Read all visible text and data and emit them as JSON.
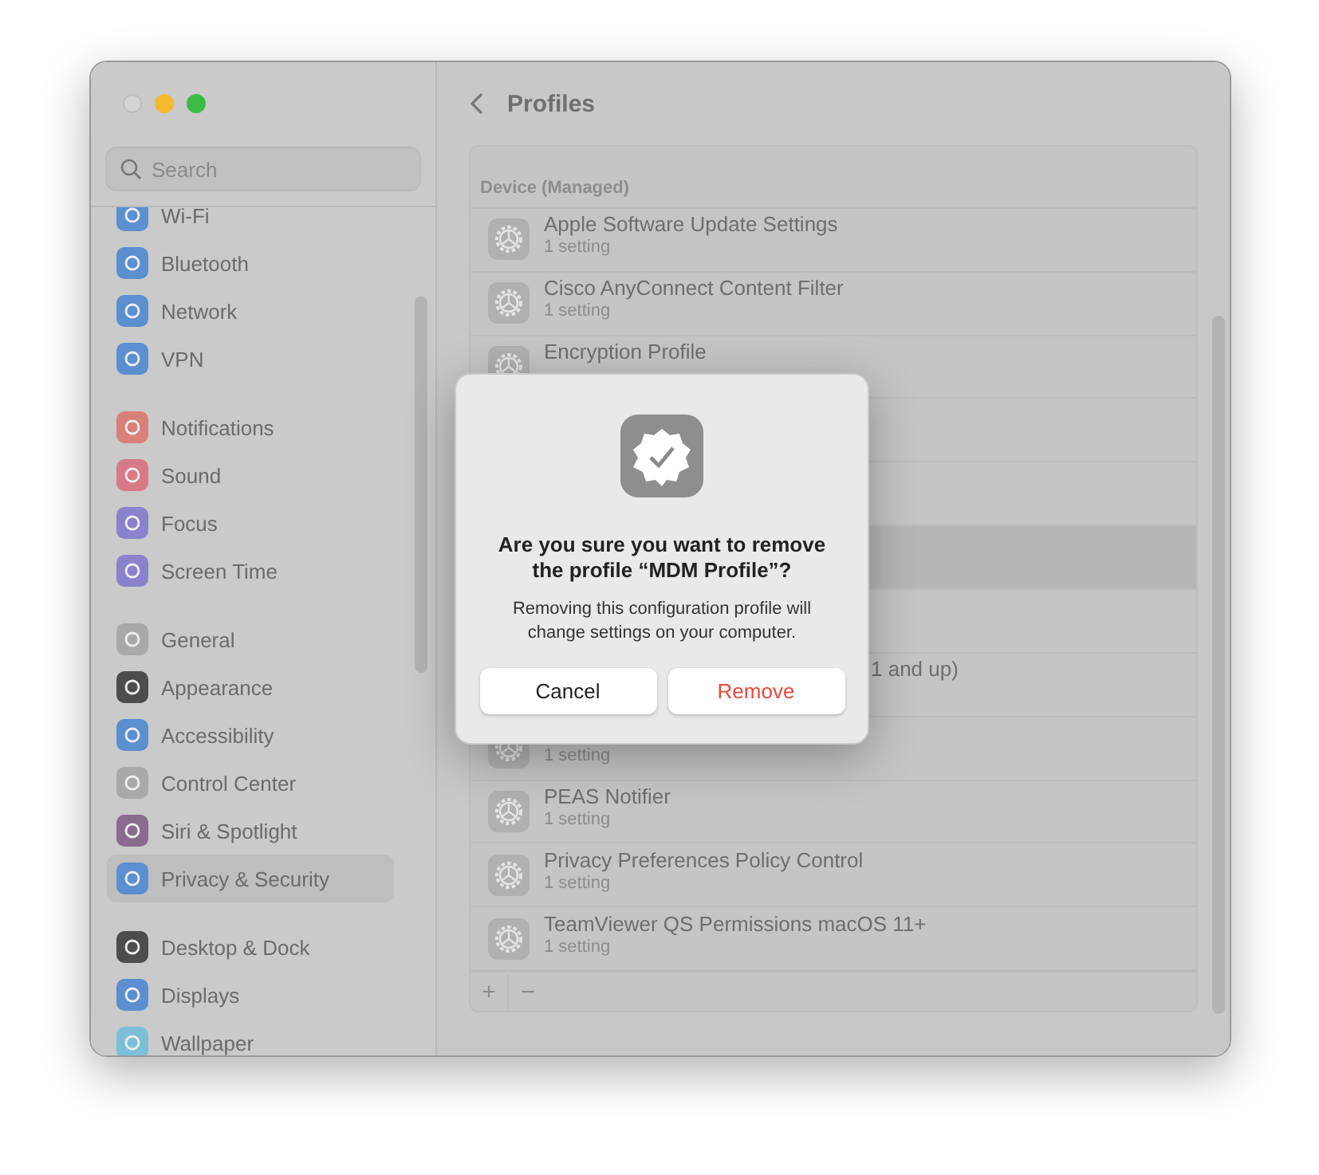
{
  "window": {
    "title": "Profiles"
  },
  "sidebar": {
    "search": {
      "placeholder": "Search"
    },
    "groups": [
      {
        "items": [
          {
            "label": "Wi-Fi",
            "color": "#5b8fd0",
            "selected": false
          },
          {
            "label": "Bluetooth",
            "color": "#5b8fd0",
            "selected": false
          },
          {
            "label": "Network",
            "color": "#5b8fd0",
            "selected": false
          },
          {
            "label": "VPN",
            "color": "#5b8fd0",
            "selected": false
          }
        ]
      },
      {
        "items": [
          {
            "label": "Notifications",
            "color": "#d98078",
            "selected": false
          },
          {
            "label": "Sound",
            "color": "#d87a86",
            "selected": false
          },
          {
            "label": "Focus",
            "color": "#8a82cc",
            "selected": false
          },
          {
            "label": "Screen Time",
            "color": "#8a82cc",
            "selected": false
          }
        ]
      },
      {
        "items": [
          {
            "label": "General",
            "color": "#a9a9a9",
            "selected": false
          },
          {
            "label": "Appearance",
            "color": "#4d4d4d",
            "selected": false
          },
          {
            "label": "Accessibility",
            "color": "#5b8fd0",
            "selected": false
          },
          {
            "label": "Control Center",
            "color": "#a9a9a9",
            "selected": false
          },
          {
            "label": "Siri & Spotlight",
            "color": "#8a6a8e",
            "selected": false
          },
          {
            "label": "Privacy & Security",
            "color": "#5b8fd0",
            "selected": true
          }
        ]
      },
      {
        "items": [
          {
            "label": "Desktop & Dock",
            "color": "#4d4d4d",
            "selected": false
          },
          {
            "label": "Displays",
            "color": "#5b8fd0",
            "selected": false
          },
          {
            "label": "Wallpaper",
            "color": "#7cc0d8",
            "selected": false
          }
        ]
      }
    ]
  },
  "profiles": {
    "section": "Device (Managed)",
    "rows": [
      {
        "kind": "full",
        "title": "Apple Software Update Settings",
        "subtitle": "1 setting",
        "selected": false
      },
      {
        "kind": "full",
        "title": "Cisco AnyConnect Content Filter",
        "subtitle": "1 setting",
        "selected": false
      },
      {
        "kind": "full",
        "title": "Encryption Profile",
        "selected": false
      },
      {
        "kind": "covered",
        "selected": false
      },
      {
        "kind": "covered",
        "selected": false
      },
      {
        "kind": "covered",
        "selected": true
      },
      {
        "kind": "covered",
        "selected": false
      },
      {
        "kind": "clipped",
        "title": "1 and up)",
        "selected": false
      },
      {
        "kind": "full",
        "subtitle": "1 setting",
        "selected": false
      },
      {
        "kind": "full",
        "title": "PEAS Notifier",
        "subtitle": "1 setting",
        "selected": false
      },
      {
        "kind": "full",
        "title": "Privacy Preferences Policy Control",
        "subtitle": "1 setting",
        "selected": false
      },
      {
        "kind": "full",
        "title": "TeamViewer QS Permissions macOS 11+",
        "subtitle": "1 setting",
        "selected": false
      }
    ],
    "add_button": "+",
    "remove_button": "−"
  },
  "dialog": {
    "title": "Are you sure you want to remove the profile “MDM Profile”?",
    "message": "Removing this configuration profile will change settings on your computer.",
    "buttons": [
      {
        "label": "Cancel",
        "kind": "default"
      },
      {
        "label": "Remove",
        "kind": "destructive"
      }
    ]
  }
}
